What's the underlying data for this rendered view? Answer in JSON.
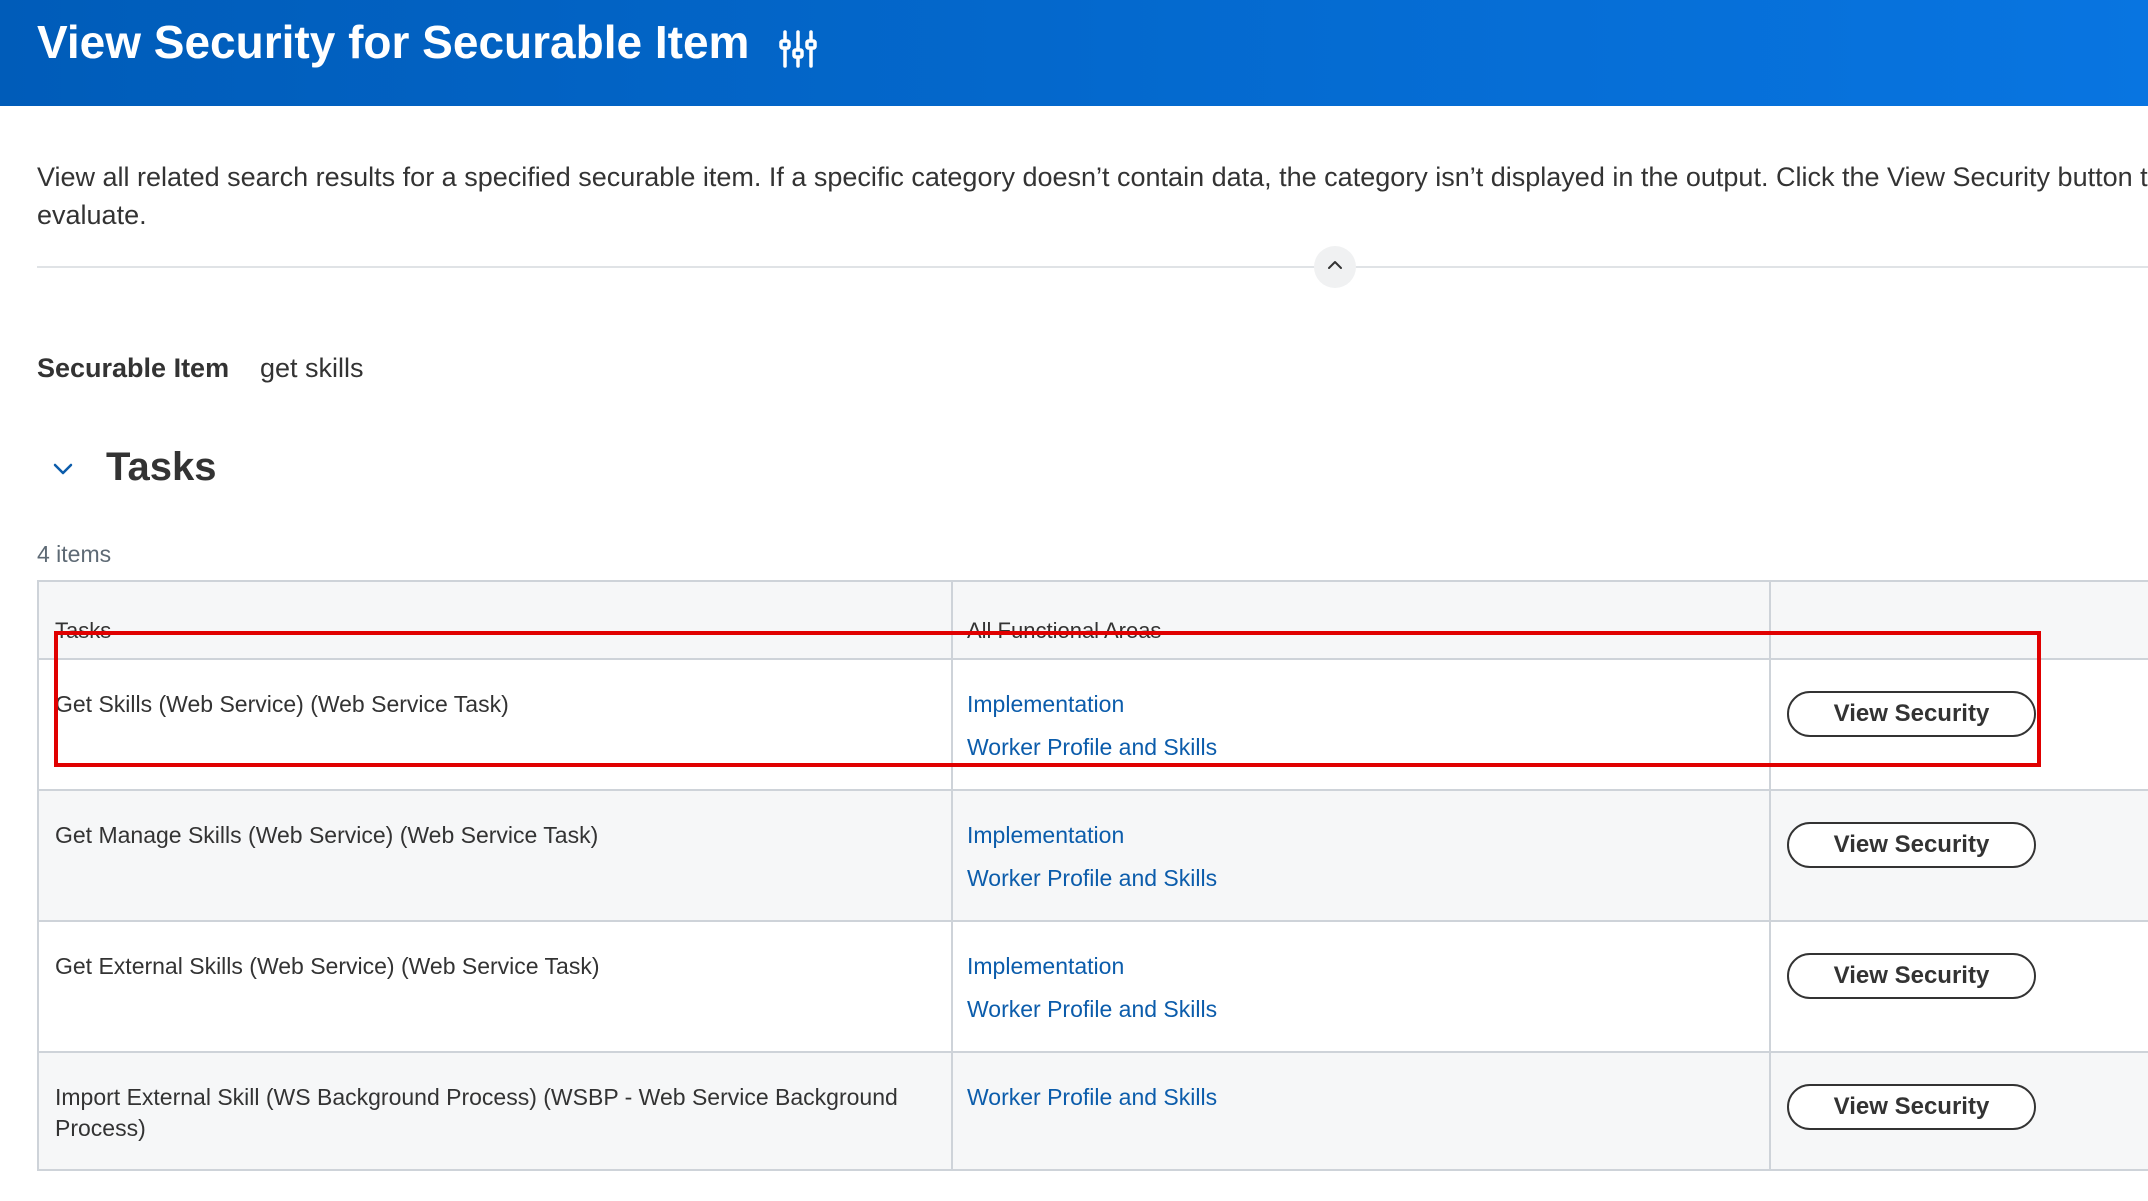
{
  "header": {
    "title": "View Security for Securable Item",
    "icon": "related-actions-sliders-icon"
  },
  "description": {
    "text": "View all related search results for a specified securable item. If a specific category doesn’t contain data, the category isn’t displayed in the output. Click the View Security button to evaluate."
  },
  "criteria": {
    "securable_item_label": "Securable Item",
    "securable_item_value": "get skills"
  },
  "section": {
    "title": "Tasks",
    "item_count": "4 items"
  },
  "table": {
    "columns": [
      "Tasks",
      "All Functional Areas",
      ""
    ],
    "rows": [
      {
        "task": "Get Skills (Web Service) (Web Service Task)",
        "areas": [
          "Implementation",
          "Worker Profile and Skills"
        ],
        "action": "View Security"
      },
      {
        "task": "Get Manage Skills (Web Service) (Web Service Task)",
        "areas": [
          "Implementation",
          "Worker Profile and Skills"
        ],
        "action": "View Security"
      },
      {
        "task": "Get External Skills (Web Service) (Web Service Task)",
        "areas": [
          "Implementation",
          "Worker Profile and Skills"
        ],
        "action": "View Security"
      },
      {
        "task": "Import External Skill (WS Background Process) (WSBP - Web Service Background Process)",
        "areas": [
          "Worker Profile and Skills"
        ],
        "action": "View Security"
      }
    ]
  },
  "colors": {
    "header_gradient_start": "#005cb9",
    "header_gradient_end": "#0875e1",
    "link": "#0b5cab",
    "highlight": "#e00000",
    "row_alt": "#f6f7f8"
  }
}
